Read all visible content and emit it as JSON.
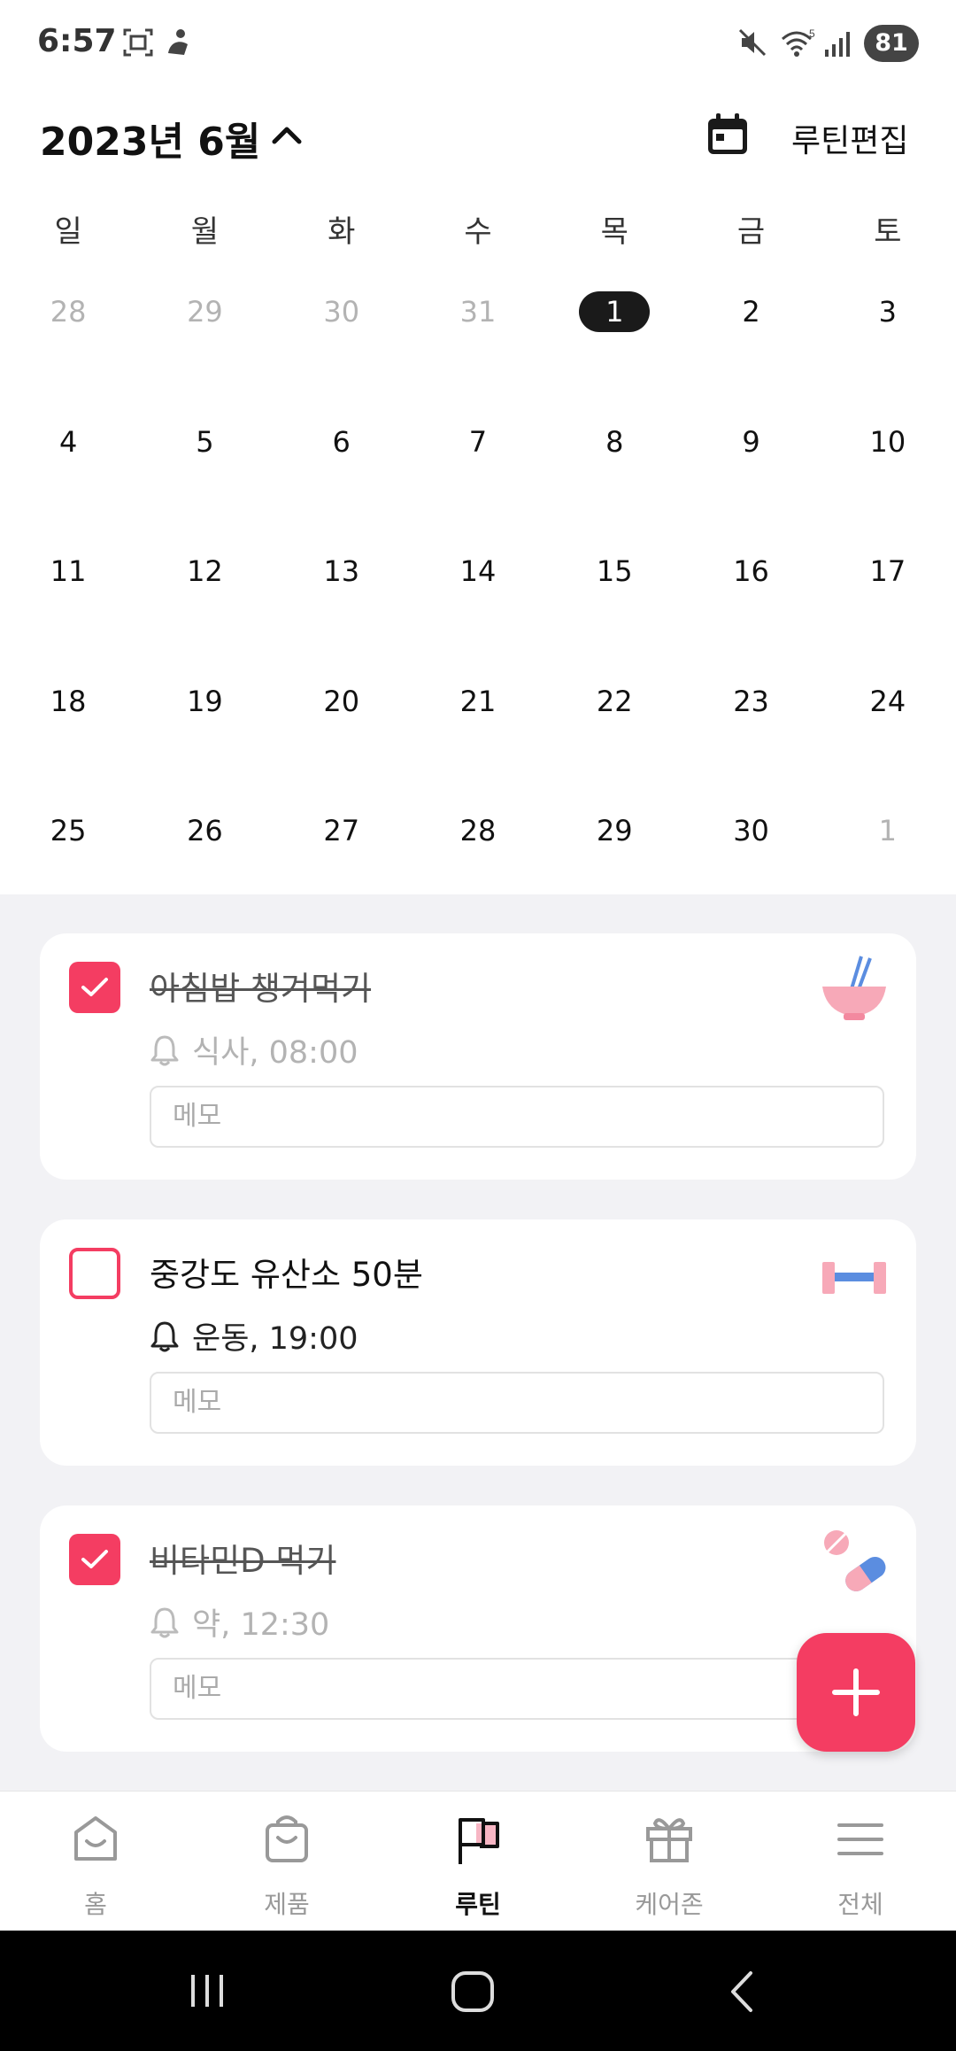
{
  "status_bar": {
    "time": "6:57",
    "battery": "81"
  },
  "header": {
    "month": "2023년 6월",
    "edit_label": "루틴편집"
  },
  "weekdays": [
    "일",
    "월",
    "화",
    "수",
    "목",
    "금",
    "토"
  ],
  "calendar": [
    [
      {
        "d": "28",
        "muted": true
      },
      {
        "d": "29",
        "muted": true
      },
      {
        "d": "30",
        "muted": true
      },
      {
        "d": "31",
        "muted": true
      },
      {
        "d": "1",
        "today": true
      },
      {
        "d": "2"
      },
      {
        "d": "3"
      }
    ],
    [
      {
        "d": "4"
      },
      {
        "d": "5"
      },
      {
        "d": "6"
      },
      {
        "d": "7"
      },
      {
        "d": "8"
      },
      {
        "d": "9"
      },
      {
        "d": "10"
      }
    ],
    [
      {
        "d": "11"
      },
      {
        "d": "12"
      },
      {
        "d": "13"
      },
      {
        "d": "14"
      },
      {
        "d": "15"
      },
      {
        "d": "16"
      },
      {
        "d": "17"
      }
    ],
    [
      {
        "d": "18"
      },
      {
        "d": "19"
      },
      {
        "d": "20"
      },
      {
        "d": "21"
      },
      {
        "d": "22"
      },
      {
        "d": "23"
      },
      {
        "d": "24"
      }
    ],
    [
      {
        "d": "25"
      },
      {
        "d": "26"
      },
      {
        "d": "27"
      },
      {
        "d": "28"
      },
      {
        "d": "29"
      },
      {
        "d": "30"
      },
      {
        "d": "1",
        "muted": true
      }
    ]
  ],
  "routines": [
    {
      "title": "아침밥 챙겨먹기",
      "subtitle": "식사, 08:00",
      "memo_placeholder": "메모",
      "checked": true,
      "icon": "rice-bowl-icon"
    },
    {
      "title": "중강도 유산소 50분",
      "subtitle": "운동, 19:00",
      "memo_placeholder": "메모",
      "checked": false,
      "icon": "dumbbell-icon"
    },
    {
      "title": "비타민D 먹기",
      "subtitle": "약, 12:30",
      "memo_placeholder": "메모",
      "checked": true,
      "icon": "pill-icon"
    }
  ],
  "nav": [
    {
      "label": "홈",
      "icon": "home-icon"
    },
    {
      "label": "제품",
      "icon": "shopping-bag-icon"
    },
    {
      "label": "루틴",
      "icon": "flag-icon",
      "active": true
    },
    {
      "label": "케어존",
      "icon": "gift-icon"
    },
    {
      "label": "전체",
      "icon": "menu-icon"
    }
  ],
  "colors": {
    "accent": "#f43d62",
    "today_bg": "#1a1a1a",
    "background": "#f2f2f5"
  }
}
